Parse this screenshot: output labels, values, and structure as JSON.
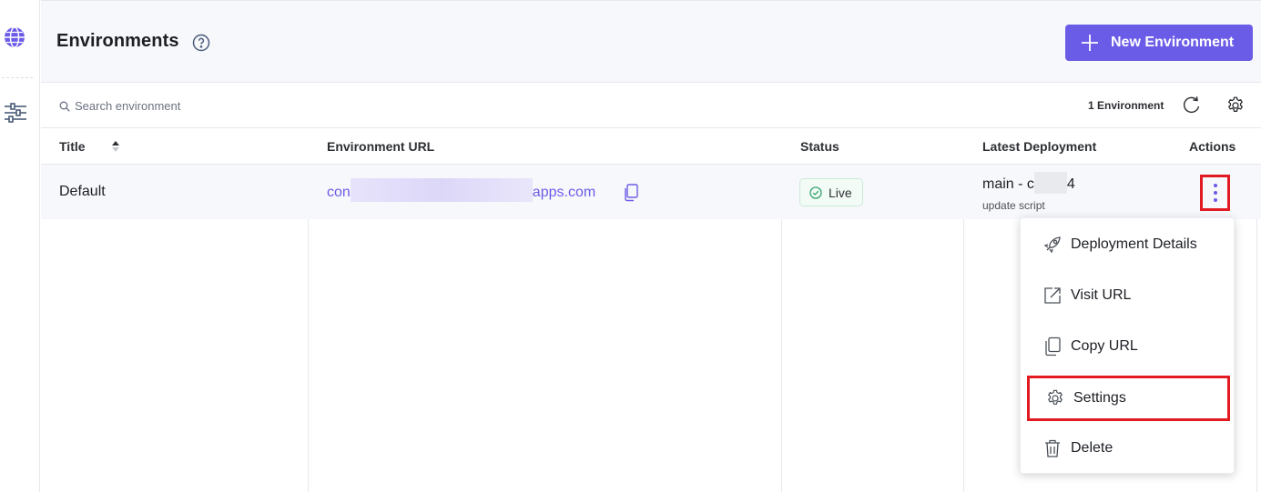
{
  "sidebar": {
    "icons": [
      "globe-icon",
      "sliders-icon"
    ]
  },
  "header": {
    "title": "Environments",
    "new_button_label": "New Environment"
  },
  "toolbar": {
    "search_placeholder": "Search environment",
    "count_label": "1 Environment"
  },
  "table": {
    "columns": [
      "Title",
      "Environment URL",
      "Status",
      "Latest Deployment",
      "Actions"
    ],
    "rows": [
      {
        "title": "Default",
        "url_prefix": "con",
        "url_suffix": "apps.com",
        "status": "Live",
        "deploy_prefix": "main - c",
        "deploy_suffix": "4",
        "deploy_message": "update script"
      }
    ]
  },
  "menu": {
    "items": [
      {
        "label": "Deployment Details",
        "icon": "rocket-icon"
      },
      {
        "label": "Visit URL",
        "icon": "external-link-icon"
      },
      {
        "label": "Copy URL",
        "icon": "copy-icon"
      },
      {
        "label": "Settings",
        "icon": "gear-icon"
      },
      {
        "label": "Delete",
        "icon": "trash-icon"
      }
    ]
  },
  "colors": {
    "accent": "#6b5ce7",
    "highlight": "#e21b23",
    "status_live": "#2fa36b"
  }
}
